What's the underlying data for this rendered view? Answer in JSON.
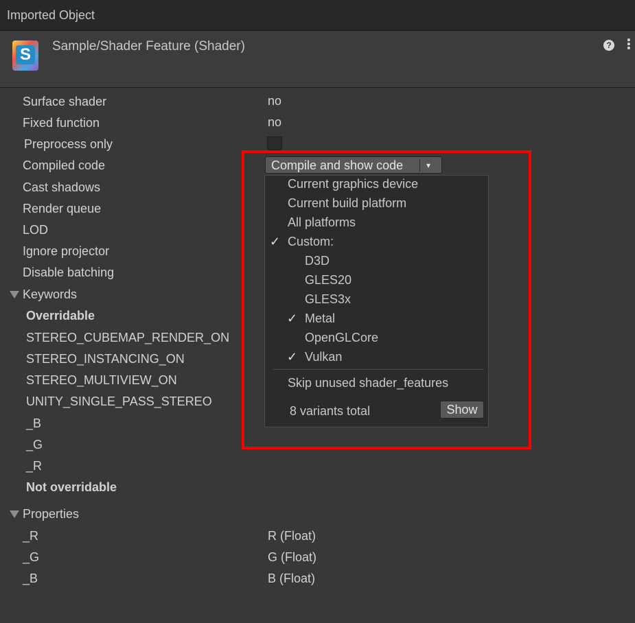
{
  "window": {
    "title": "Imported Object"
  },
  "header": {
    "asset_name": "Sample/Shader Feature (Shader)",
    "icon_letter": "S"
  },
  "properties": [
    {
      "label": "Surface shader",
      "value": "no"
    },
    {
      "label": "Fixed function",
      "value": "no"
    },
    {
      "label": "Preprocess only",
      "value": ""
    },
    {
      "label": "Compiled code",
      "value": ""
    },
    {
      "label": "Cast shadows",
      "value": ""
    },
    {
      "label": "Render queue",
      "value": ""
    },
    {
      "label": "LOD",
      "value": ""
    },
    {
      "label": "Ignore projector",
      "value": ""
    },
    {
      "label": "Disable batching",
      "value": ""
    }
  ],
  "compile_button": {
    "label": "Compile and show code",
    "arrow": "▾"
  },
  "dropdown": {
    "items": [
      {
        "label": "Current graphics device",
        "checked": false
      },
      {
        "label": "Current build platform",
        "checked": false
      },
      {
        "label": "All platforms",
        "checked": false
      },
      {
        "label": "Custom:",
        "checked": true
      }
    ],
    "custom_items": [
      {
        "label": "D3D",
        "checked": false
      },
      {
        "label": "GLES20",
        "checked": false
      },
      {
        "label": "GLES3x",
        "checked": false
      },
      {
        "label": "Metal",
        "checked": true
      },
      {
        "label": "OpenGLCore",
        "checked": false
      },
      {
        "label": "Vulkan",
        "checked": true
      }
    ],
    "skip_label": "Skip unused shader_features",
    "variants_label": "8 variants total",
    "show_label": "Show",
    "checkmark": "✓"
  },
  "keywords": {
    "title": "Keywords",
    "overridable_title": "Overridable",
    "overridable": [
      "STEREO_CUBEMAP_RENDER_ON",
      "STEREO_INSTANCING_ON",
      "STEREO_MULTIVIEW_ON",
      "UNITY_SINGLE_PASS_STEREO",
      "_B",
      "_G",
      "_R"
    ],
    "not_overridable_title": "Not overridable"
  },
  "shader_properties": {
    "title": "Properties",
    "items": [
      {
        "name": "_R",
        "type": "R (Float)"
      },
      {
        "name": "_G",
        "type": "G (Float)"
      },
      {
        "name": "_B",
        "type": "B (Float)"
      }
    ]
  },
  "colors": {
    "background": "#383838",
    "highlight": "#ff0000"
  }
}
